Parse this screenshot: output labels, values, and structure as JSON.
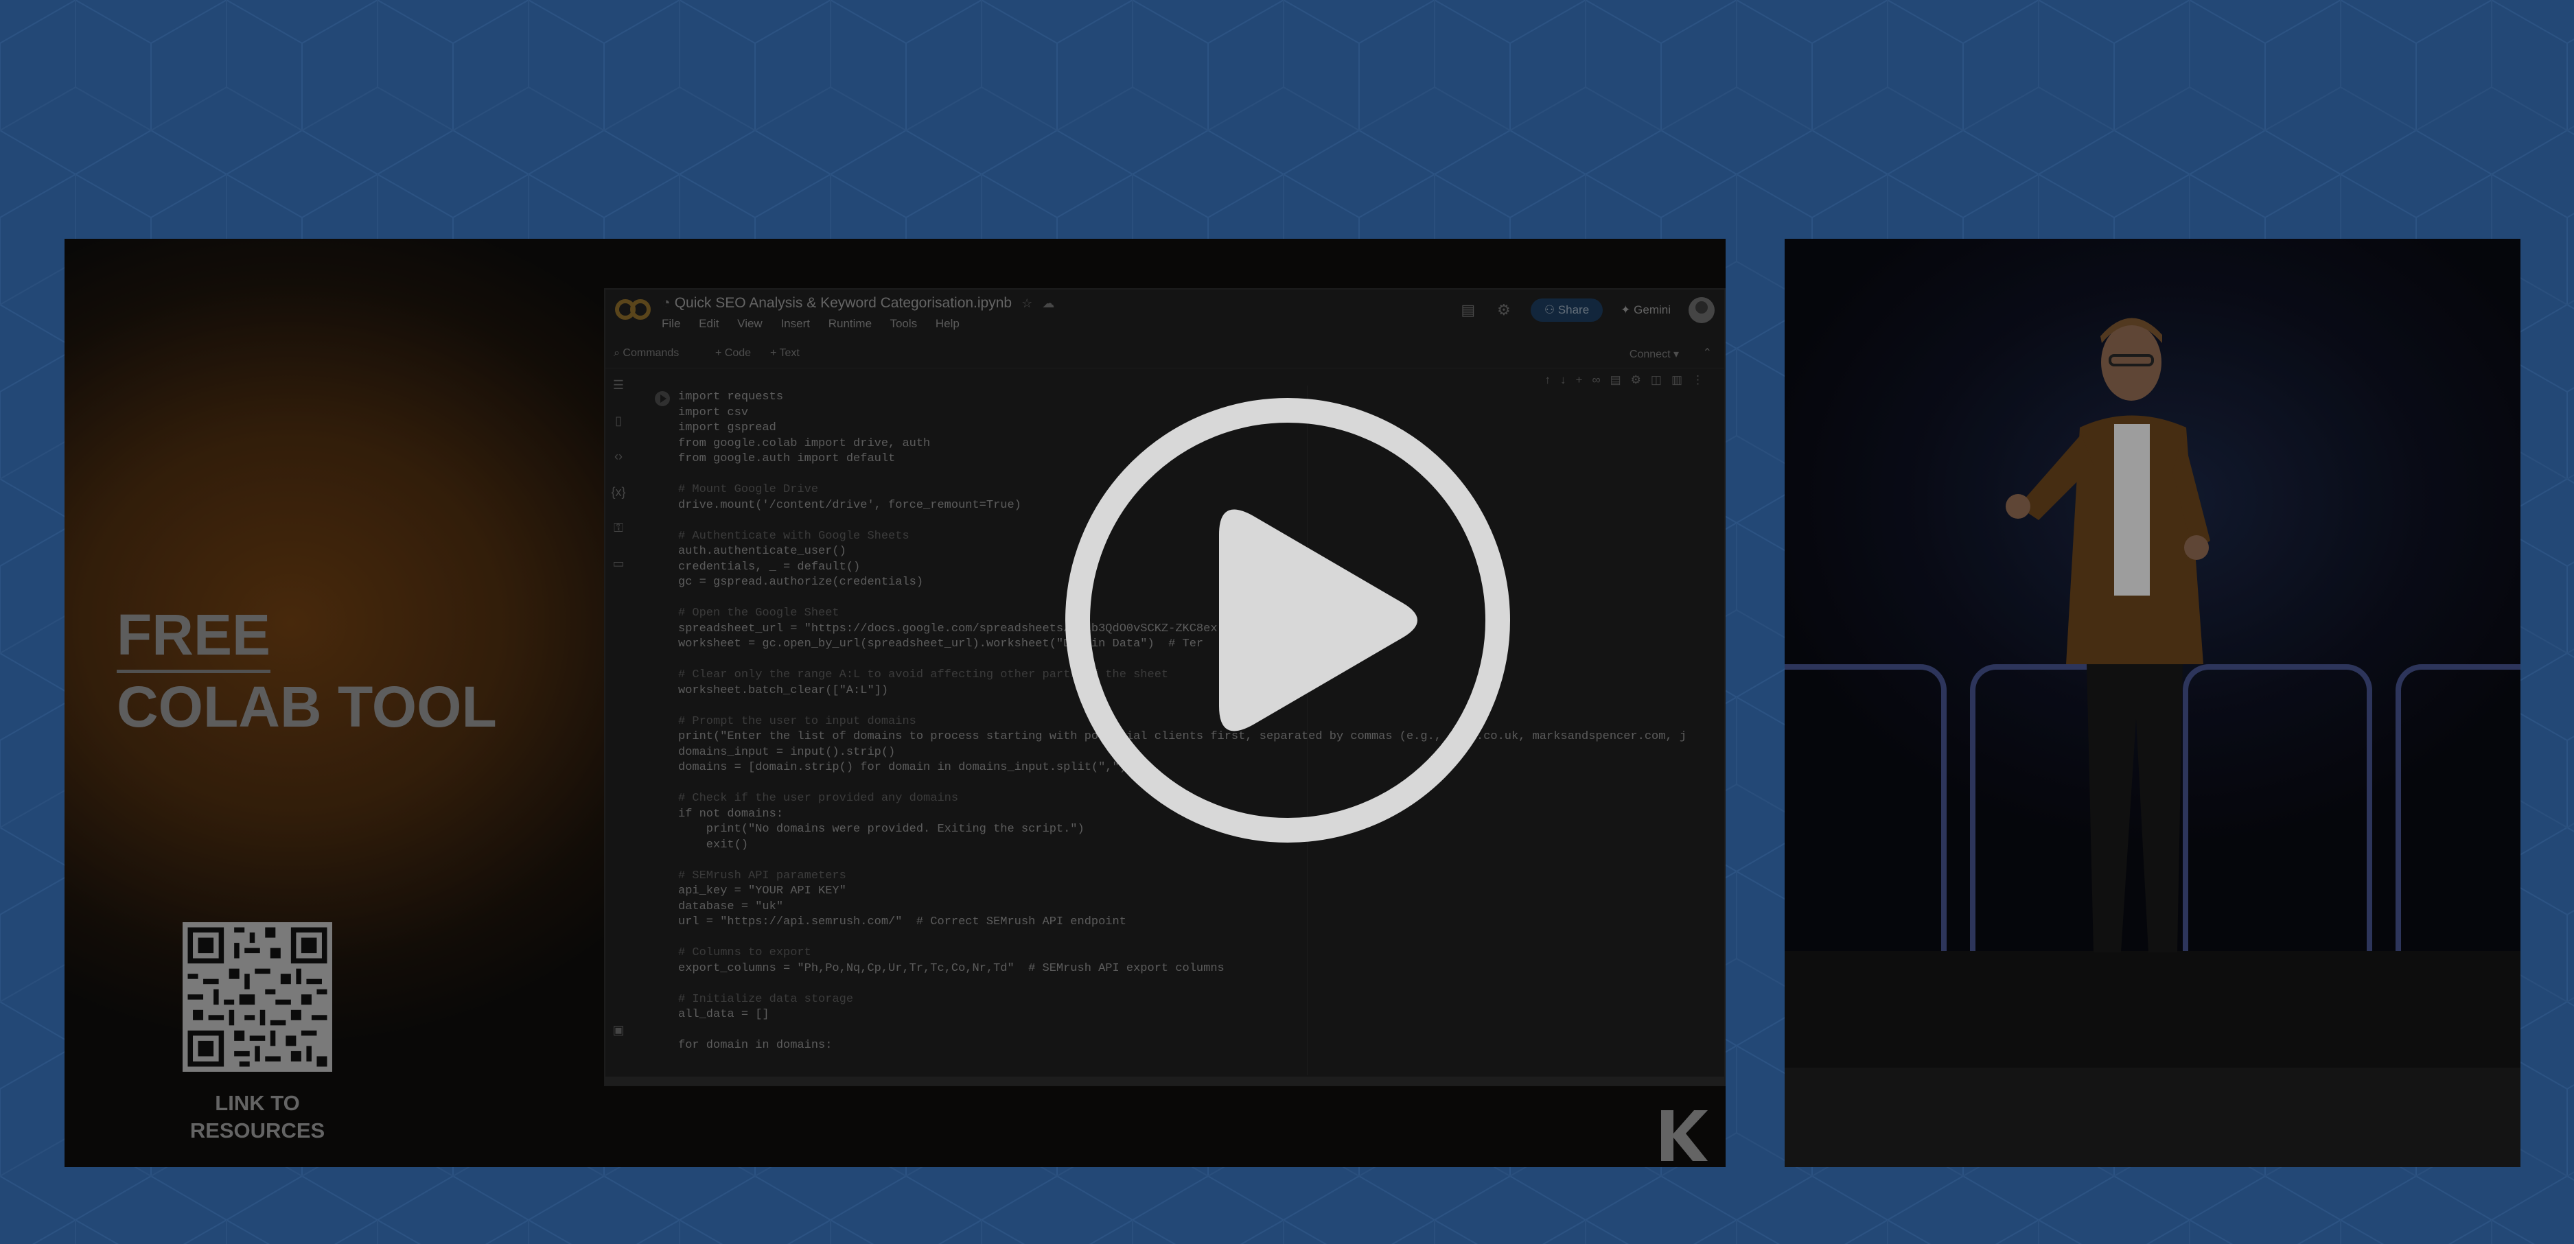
{
  "slide": {
    "title_line1": "FREE",
    "title_line2": "COLAB TOOL",
    "qr_caption_line1": "LINK TO",
    "qr_caption_line2": "RESOURCES"
  },
  "colab": {
    "file_name": "Quick SEO Analysis & Keyword Categorisation.ipynb",
    "menu": [
      "File",
      "Edit",
      "View",
      "Insert",
      "Runtime",
      "Tools",
      "Help"
    ],
    "share_label": "Share",
    "gemini_label": "Gemini",
    "commands_label": "Commands",
    "code_label": "+ Code",
    "text_label": "+ Text",
    "connect_label": "Connect",
    "code_lines": [
      "import requests",
      "import csv",
      "import gspread",
      "from google.colab import drive, auth",
      "from google.auth import default",
      "",
      "# Mount Google Drive",
      "drive.mount('/content/drive', force_remount=True)",
      "",
      "# Authenticate with Google Sheets",
      "auth.authenticate_user()",
      "credentials, _ = default()",
      "gc = gspread.authorize(credentials)",
      "",
      "# Open the Google Sheet",
      "spreadsheet_url = \"https://docs.google.com/spreadsheets/d/1b3QdO0vSCKZ-ZKC8ex",
      "worksheet = gc.open_by_url(spreadsheet_url).worksheet(\"Domain Data\")  # Ter",
      "",
      "# Clear only the range A:L to avoid affecting other parts of the sheet",
      "worksheet.batch_clear([\"A:L\"])",
      "",
      "# Prompt the user to input domains",
      "print(\"Enter the list of domains to process starting with potential clients first, separated by commas (e.g., next.co.uk, marksandspencer.com, j",
      "domains_input = input().strip()",
      "domains = [domain.strip() for domain in domains_input.split(\",\")]",
      "",
      "# Check if the user provided any domains",
      "if not domains:",
      "    print(\"No domains were provided. Exiting the script.\")",
      "    exit()",
      "",
      "# SEMrush API parameters",
      "api_key = \"YOUR API KEY\"",
      "database = \"uk\"",
      "url = \"https://api.semrush.com/\"  # Correct SEMrush API endpoint",
      "",
      "# Columns to export",
      "export_columns = \"Ph,Po,Nq,Cp,Ur,Tr,Tc,Co,Nr,Td\"  # SEMrush API export columns",
      "",
      "# Initialize data storage",
      "all_data = []",
      "",
      "for domain in domains:"
    ]
  },
  "colors": {
    "page_background": "#234876",
    "play_button": "#d8d8d8"
  },
  "icons": {
    "play": "play-icon",
    "logo": "k-logo-icon"
  }
}
